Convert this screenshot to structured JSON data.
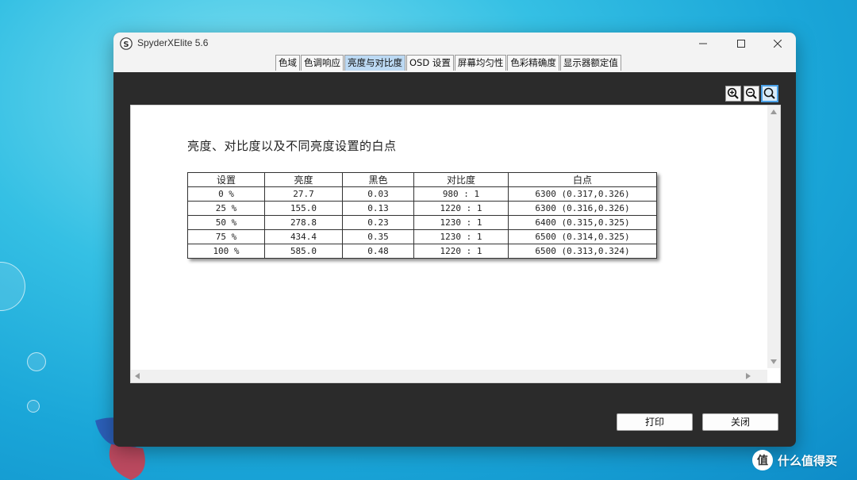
{
  "window": {
    "title": "SpyderXElite 5.6"
  },
  "tabs": [
    {
      "label": "色域",
      "active": false
    },
    {
      "label": "色调响应",
      "active": false
    },
    {
      "label": "亮度与对比度",
      "active": true
    },
    {
      "label": "OSD 设置",
      "active": false
    },
    {
      "label": "屏幕均匀性",
      "active": false
    },
    {
      "label": "色彩精确度",
      "active": false
    },
    {
      "label": "显示器额定值",
      "active": false
    }
  ],
  "report": {
    "title": "亮度、对比度以及不同亮度设置的白点",
    "headers": [
      "设置",
      "亮度",
      "黑色",
      "对比度",
      "白点"
    ],
    "rows": [
      [
        "0 %",
        "27.7",
        "0.03",
        "980 : 1",
        "6300 (0.317,0.326)"
      ],
      [
        "25 %",
        "155.0",
        "0.13",
        "1220 : 1",
        "6300 (0.316,0.326)"
      ],
      [
        "50 %",
        "278.8",
        "0.23",
        "1230 : 1",
        "6400 (0.315,0.325)"
      ],
      [
        "75 %",
        "434.4",
        "0.35",
        "1230 : 1",
        "6500 (0.314,0.325)"
      ],
      [
        "100 %",
        "585.0",
        "0.48",
        "1220 : 1",
        "6500 (0.313,0.324)"
      ]
    ]
  },
  "buttons": {
    "print": "打印",
    "close": "关闭"
  },
  "watermark": {
    "text": "什么值得买",
    "logo": "值"
  },
  "colors": {
    "active_tab": "#bcd9f3",
    "window_bg": "#2b2b2b",
    "zoom_active": "#4aa0e6"
  }
}
